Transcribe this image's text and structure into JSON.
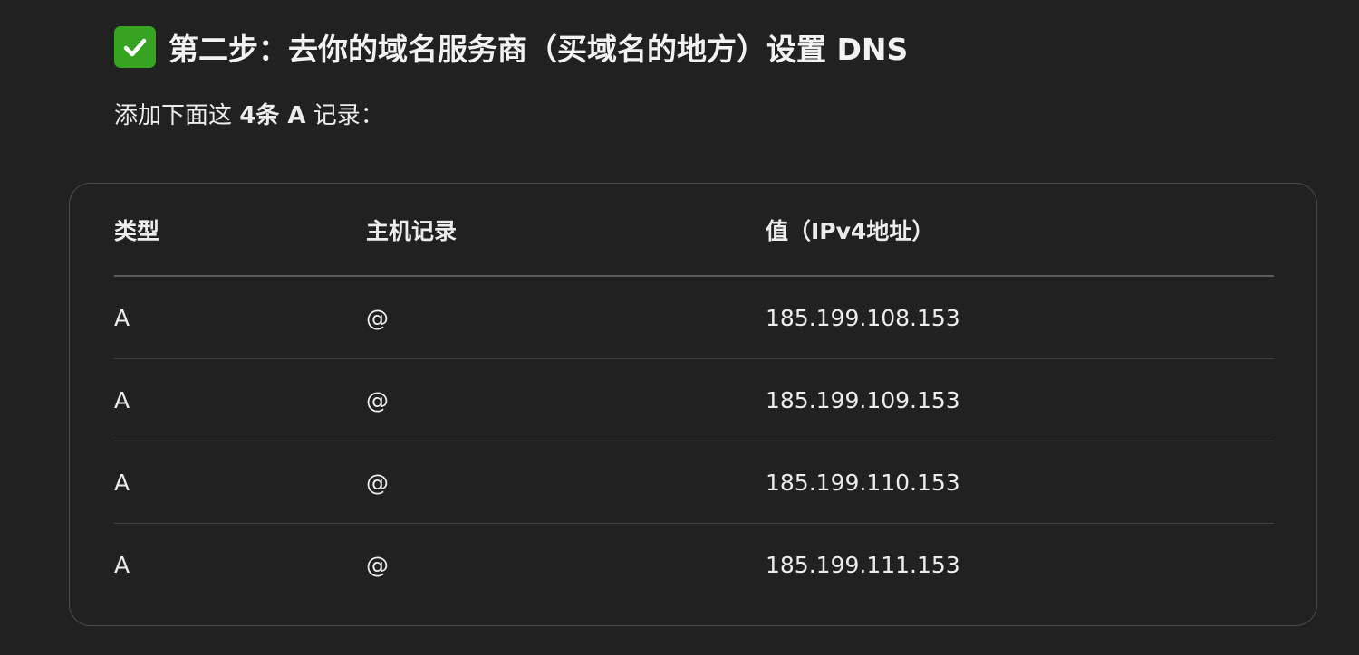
{
  "heading": {
    "icon": "check-mark-button-icon",
    "text": "第二步：去你的域名服务商（买域名的地方）设置 DNS"
  },
  "intro": {
    "prefix": "添加下面这 ",
    "emphasis": "4条 A",
    "suffix": " 记录："
  },
  "table": {
    "headers": [
      "类型",
      "主机记录",
      "值（IPv4地址）"
    ],
    "rows": [
      [
        "A",
        "@",
        "185.199.108.153"
      ],
      [
        "A",
        "@",
        "185.199.109.153"
      ],
      [
        "A",
        "@",
        "185.199.110.153"
      ],
      [
        "A",
        "@",
        "185.199.111.153"
      ]
    ]
  },
  "colors": {
    "background": "#212121",
    "text": "#ececec",
    "check_icon": "#36a420"
  }
}
